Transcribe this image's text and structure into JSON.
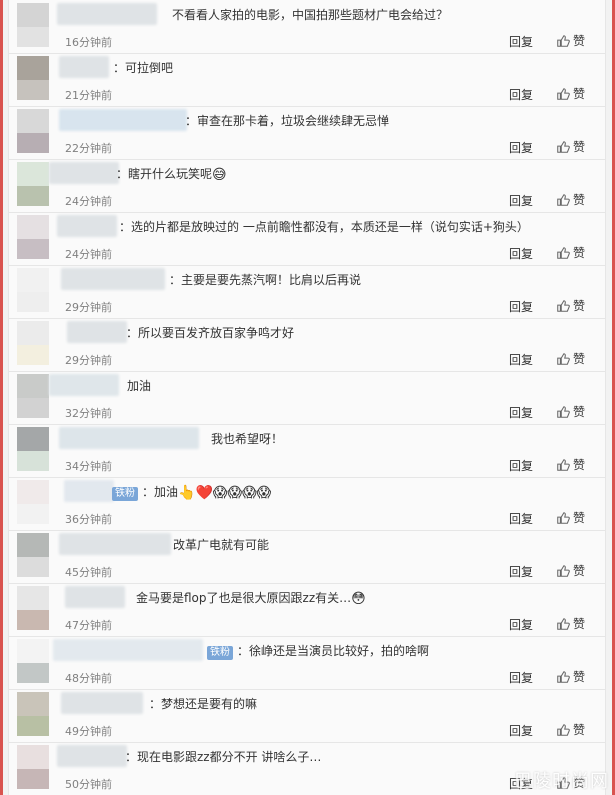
{
  "labels": {
    "reply": "回复",
    "like": "赞"
  },
  "comments": [
    {
      "text": "不看看人家拍的电影，中国拍那些题材广电会给过？",
      "time": "16分钟前"
    },
    {
      "text": "：可拉倒吧",
      "time": "21分钟前"
    },
    {
      "text": "：审查在那卡着，垃圾会继续肆无忌惮",
      "time": "22分钟前"
    },
    {
      "text": "：瞎开什么玩笑呢",
      "emoji": "😅",
      "time": "24分钟前"
    },
    {
      "text": "：选的片都是放映过的 一点前瞻性都没有，本质还是一样（说句实话+狗头）",
      "time": "24分钟前"
    },
    {
      "text": "：主要是要先蒸汽啊！比肩以后再说",
      "time": "29分钟前"
    },
    {
      "text": "：所以要百发齐放百家争鸣才好",
      "time": "29分钟前"
    },
    {
      "text": "加油",
      "time": "32分钟前"
    },
    {
      "text": "我也希望呀！",
      "time": "34分钟前"
    },
    {
      "badge": "铁粉",
      "text": "：加油",
      "emoji": "👆❤️😱😱😱😱",
      "time": "36分钟前"
    },
    {
      "text": "改革广电就有可能",
      "time": "45分钟前"
    },
    {
      "text": "金马要是flop了也是很大原因跟zz有关…",
      "emoji": "😳",
      "time": "47分钟前"
    },
    {
      "badge": "铁粉",
      "text": "：徐峥还是当演员比较好，拍的啥啊",
      "time": "48分钟前"
    },
    {
      "text": "：梦想还是要有的嘛",
      "time": "49分钟前"
    },
    {
      "text": "：现在电影跟zz都分不开 讲啥么子…",
      "time": "50分钟前"
    }
  ],
  "watermark": "巴陵时尚网"
}
